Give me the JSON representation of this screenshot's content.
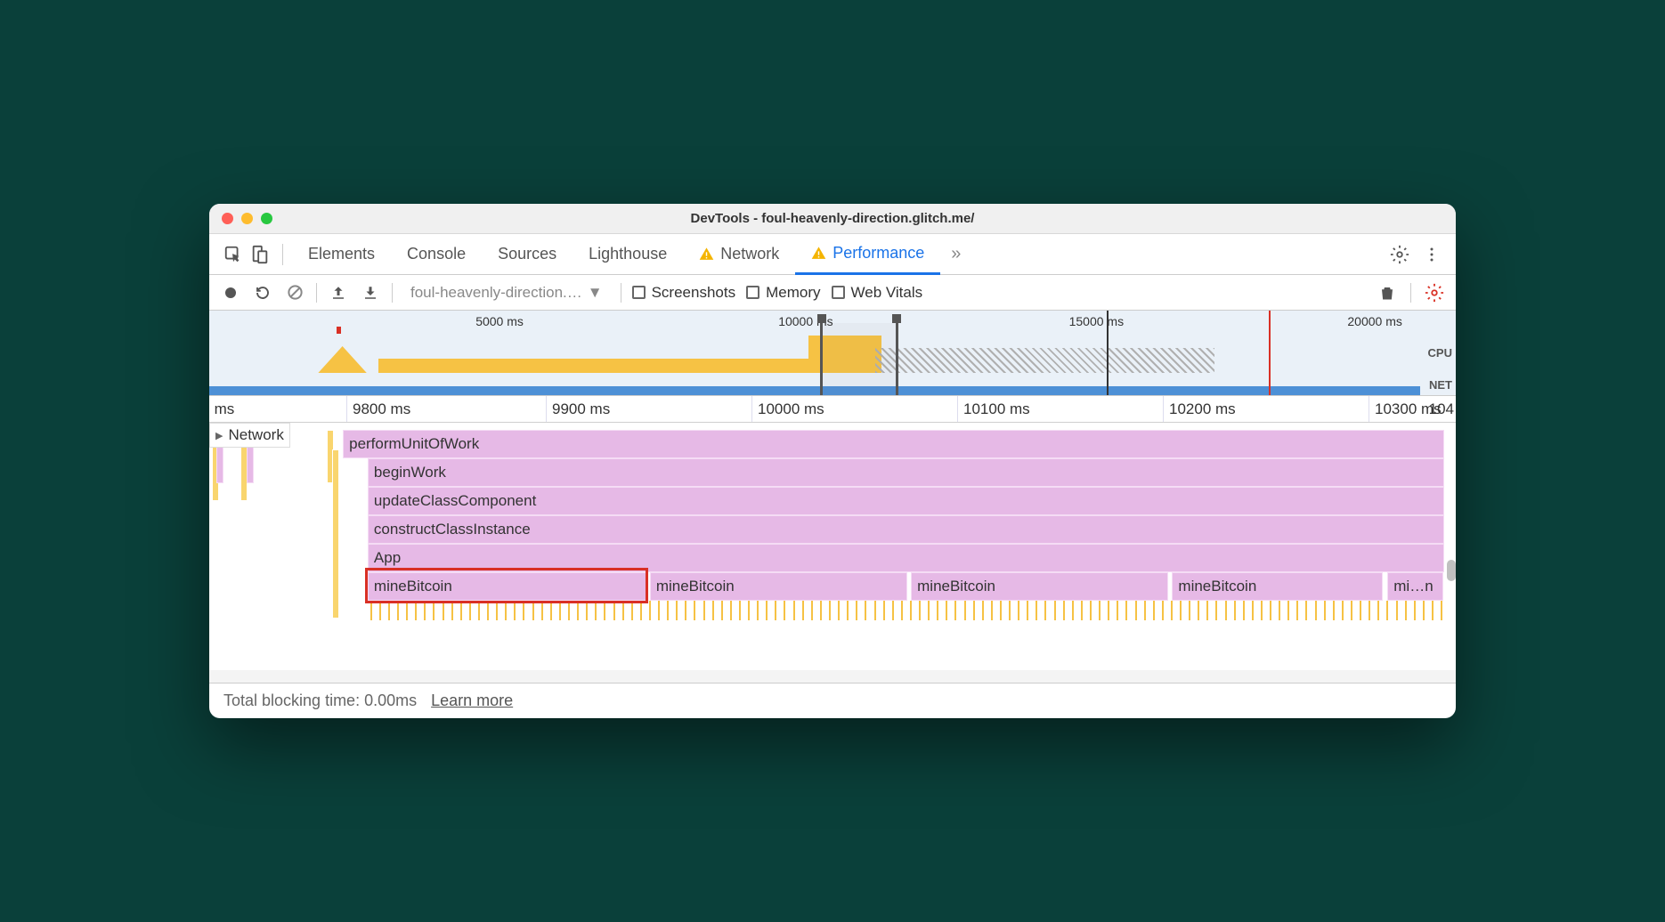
{
  "window": {
    "title": "DevTools - foul-heavenly-direction.glitch.me/"
  },
  "tabs": {
    "items": [
      {
        "label": "Elements",
        "warn": false
      },
      {
        "label": "Console",
        "warn": false
      },
      {
        "label": "Sources",
        "warn": false
      },
      {
        "label": "Lighthouse",
        "warn": false
      },
      {
        "label": "Network",
        "warn": true
      },
      {
        "label": "Performance",
        "warn": true
      }
    ]
  },
  "toolbar": {
    "select_label": "foul-heavenly-direction.…",
    "screenshots_label": "Screenshots",
    "memory_label": "Memory",
    "webvitals_label": "Web Vitals"
  },
  "overview": {
    "times": [
      "5000 ms",
      "10000 ms",
      "15000 ms",
      "20000 ms"
    ],
    "cpu_label": "CPU",
    "net_label": "NET"
  },
  "ruler": {
    "ticks": [
      "ms",
      "9800 ms",
      "9900 ms",
      "10000 ms",
      "10100 ms",
      "10200 ms",
      "10300 ms",
      "104"
    ]
  },
  "tracks": {
    "network_label": "Network",
    "stack": [
      "performUnitOfWork",
      "beginWork",
      "updateClassComponent",
      "constructClassInstance",
      "App"
    ],
    "mine_label": "mineBitcoin",
    "mine_last": "mi…n"
  },
  "footer": {
    "tbt": "Total blocking time: 0.00ms",
    "learn": "Learn more"
  }
}
